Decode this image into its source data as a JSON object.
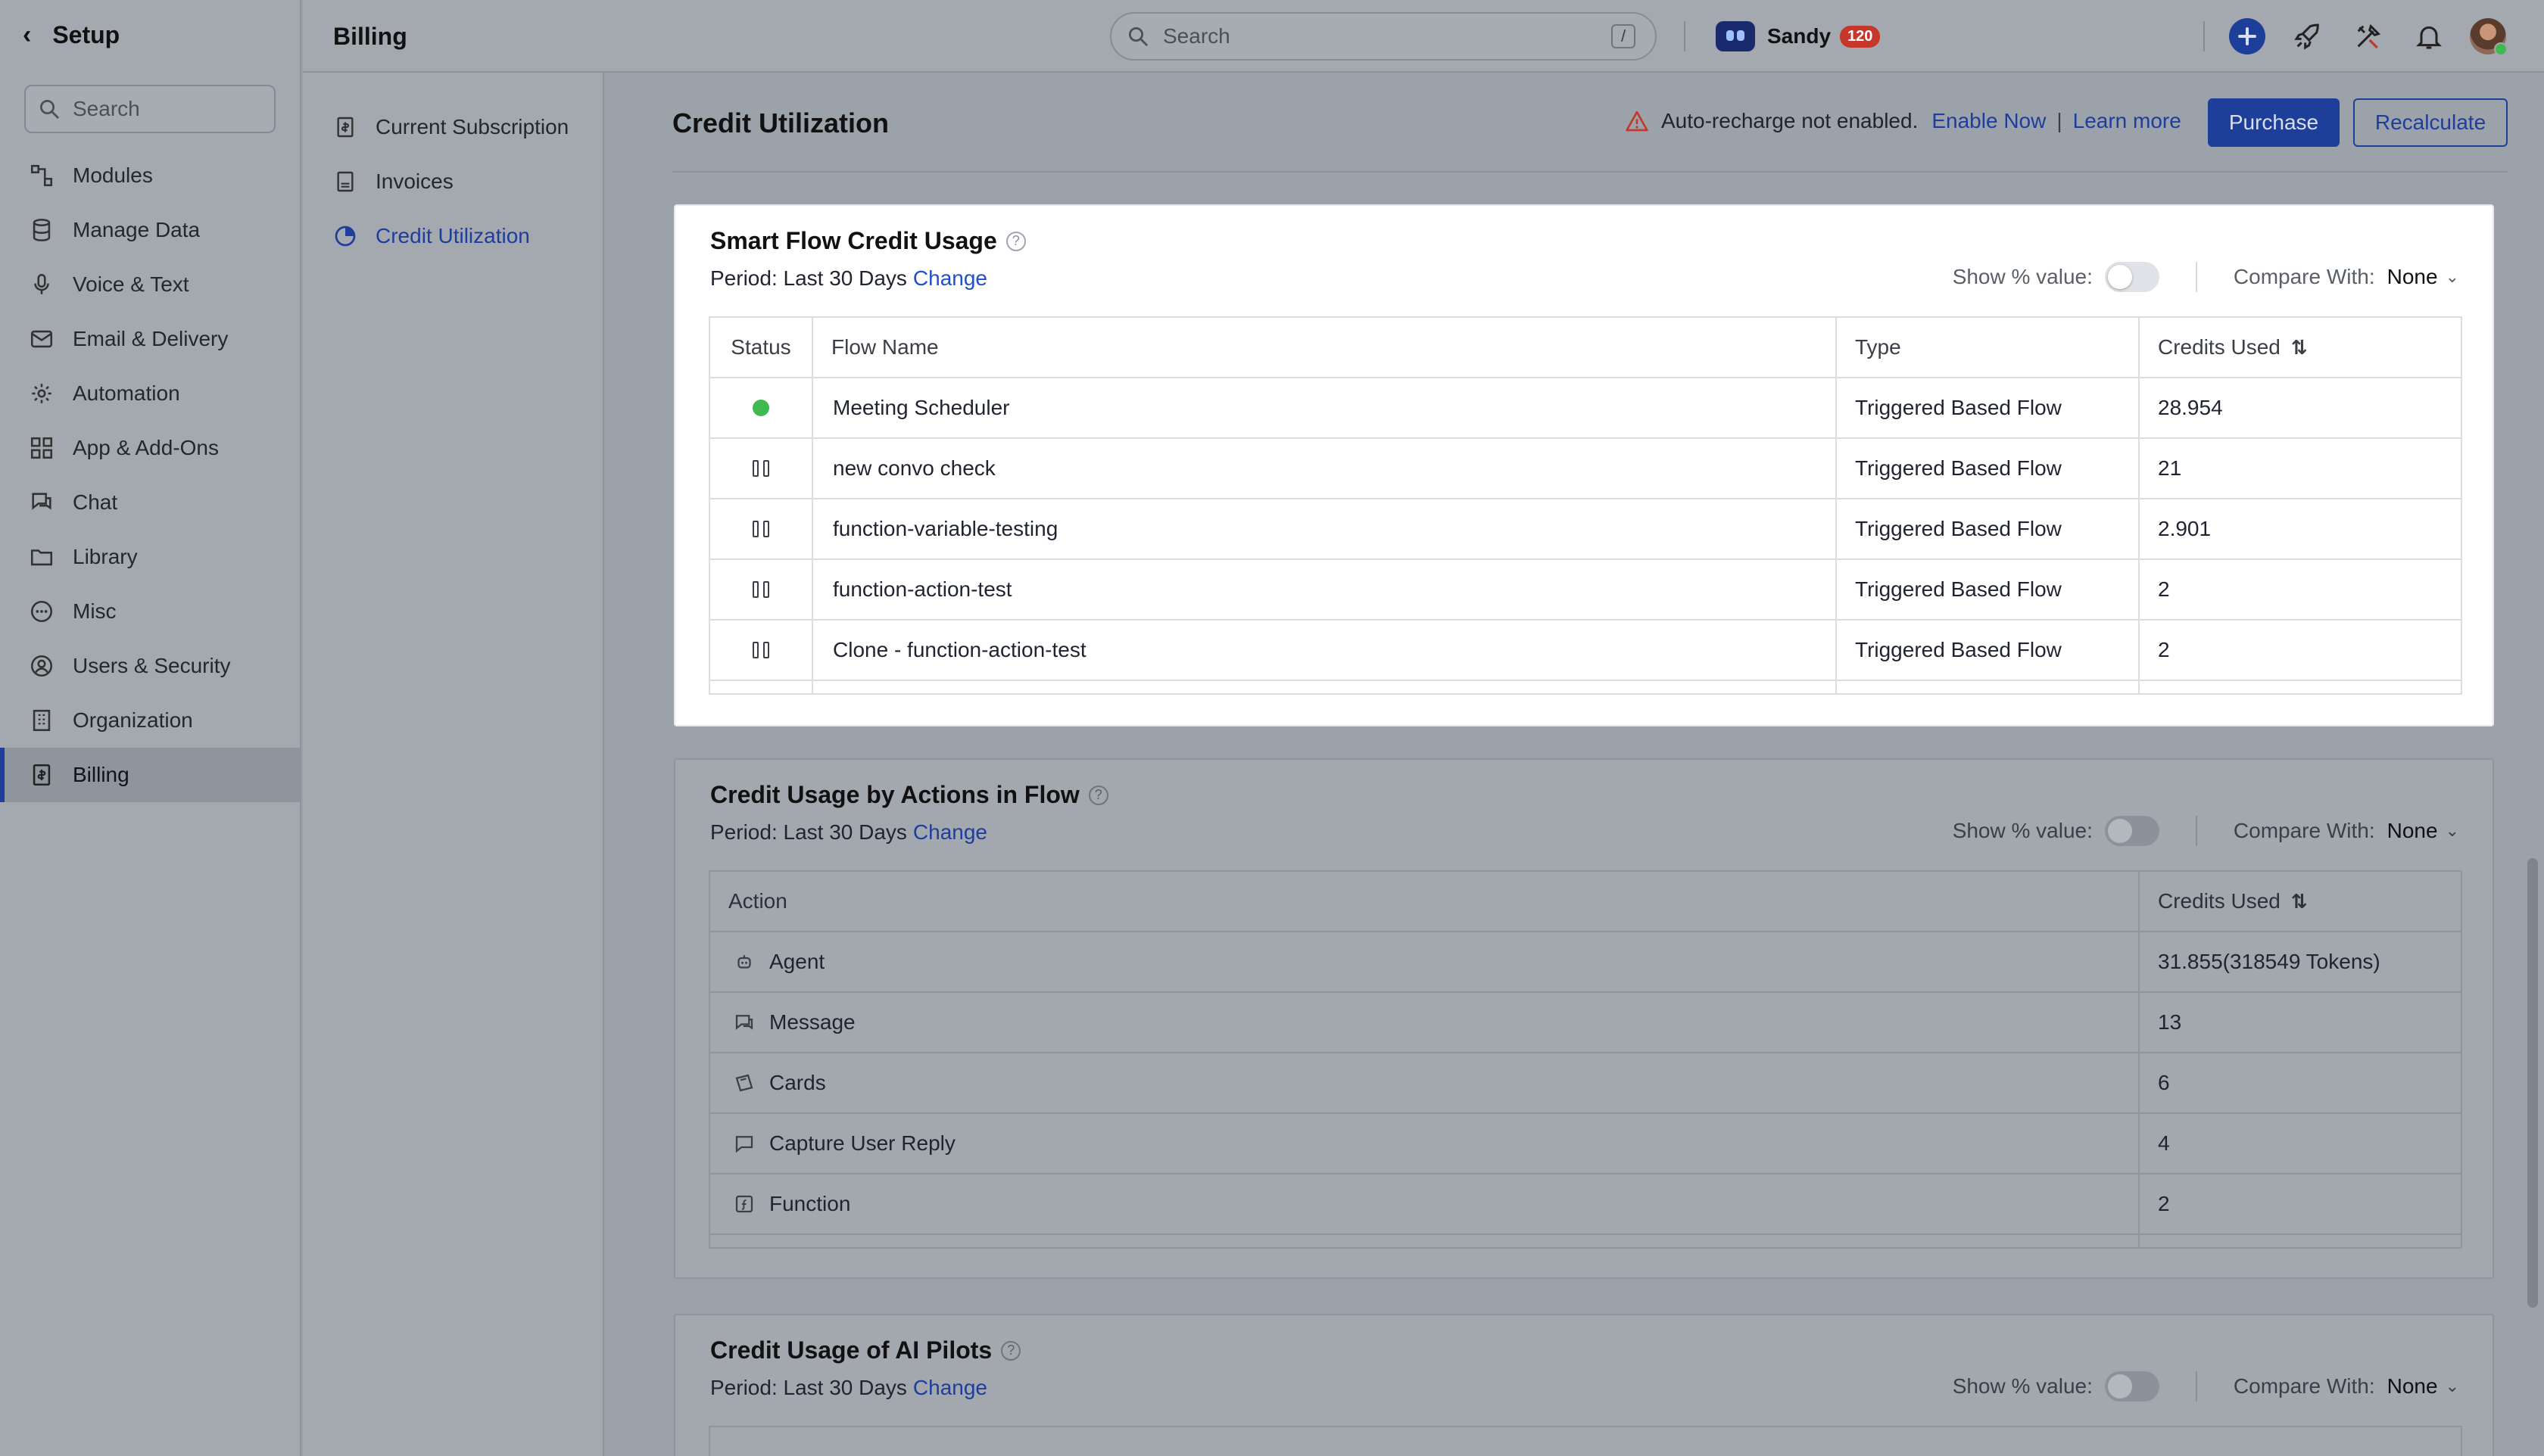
{
  "sidebar": {
    "title": "Setup",
    "search_placeholder": "Search",
    "items": [
      {
        "label": "Modules",
        "icon": "modules-icon"
      },
      {
        "label": "Manage Data",
        "icon": "database-icon"
      },
      {
        "label": "Voice & Text",
        "icon": "microphone-icon"
      },
      {
        "label": "Email & Delivery",
        "icon": "mail-icon"
      },
      {
        "label": "Automation",
        "icon": "automation-icon"
      },
      {
        "label": "App & Add-Ons",
        "icon": "apps-grid-icon"
      },
      {
        "label": "Chat",
        "icon": "chat-icon"
      },
      {
        "label": "Library",
        "icon": "folder-icon"
      },
      {
        "label": "Misc",
        "icon": "more-circle-icon"
      },
      {
        "label": "Users & Security",
        "icon": "user-circle-icon"
      },
      {
        "label": "Organization",
        "icon": "building-icon"
      },
      {
        "label": "Billing",
        "icon": "billing-icon",
        "active": true
      }
    ]
  },
  "subnav": {
    "title": "Billing",
    "items": [
      {
        "label": "Current Subscription",
        "icon": "receipt-icon"
      },
      {
        "label": "Invoices",
        "icon": "invoice-icon"
      },
      {
        "label": "Credit Utilization",
        "icon": "pie-icon",
        "active": true
      }
    ]
  },
  "topbar": {
    "search_placeholder": "Search",
    "search_shortcut": "/",
    "user_name": "Sandy",
    "user_badge": "120"
  },
  "page": {
    "title": "Credit Utilization",
    "alert_text": "Auto-recharge not enabled.",
    "enable_now": "Enable Now",
    "pipe": "|",
    "learn_more": "Learn more",
    "purchase_label": "Purchase",
    "recalculate_label": "Recalculate"
  },
  "common": {
    "period_prefix": "Period: Last 30 Days",
    "change": "Change",
    "show_pct": "Show % value:",
    "compare_with": "Compare With:",
    "compare_value": "None"
  },
  "flow_card": {
    "title": "Smart Flow Credit Usage",
    "headers": {
      "status": "Status",
      "flow": "Flow Name",
      "type": "Type",
      "credits": "Credits Used"
    },
    "rows": [
      {
        "status": "active",
        "flow": "Meeting Scheduler",
        "type": "Triggered Based Flow",
        "credits": "28.954"
      },
      {
        "status": "paused",
        "flow": "new convo check",
        "type": "Triggered Based Flow",
        "credits": "21"
      },
      {
        "status": "paused",
        "flow": "function-variable-testing",
        "type": "Triggered Based Flow",
        "credits": "2.901"
      },
      {
        "status": "paused",
        "flow": "function-action-test",
        "type": "Triggered Based Flow",
        "credits": "2"
      },
      {
        "status": "paused",
        "flow": "Clone - function-action-test",
        "type": "Triggered Based Flow",
        "credits": "2"
      }
    ]
  },
  "actions_card": {
    "title": "Credit Usage by Actions in Flow",
    "headers": {
      "action": "Action",
      "credits": "Credits Used"
    },
    "rows": [
      {
        "action": "Agent",
        "icon": "agent-icon",
        "credits": "31.855(318549 Tokens)"
      },
      {
        "action": "Message",
        "icon": "message-icon",
        "credits": "13"
      },
      {
        "action": "Cards",
        "icon": "cards-icon",
        "credits": "6"
      },
      {
        "action": "Capture User Reply",
        "icon": "reply-icon",
        "credits": "4"
      },
      {
        "action": "Function",
        "icon": "function-icon",
        "credits": "2"
      }
    ]
  },
  "pilots_card": {
    "title": "Credit Usage of AI Pilots"
  },
  "colors": {
    "accent": "#1d3f99",
    "active_status": "#3fb950",
    "alert": "#c6372b"
  }
}
